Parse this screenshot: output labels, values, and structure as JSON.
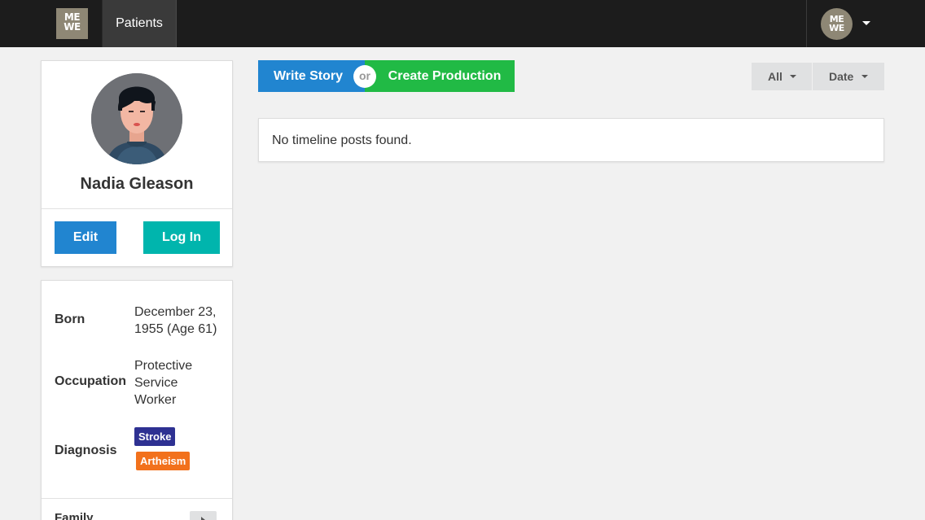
{
  "nav": {
    "logo_line1": "ME",
    "logo_line2": "WE",
    "patients_label": "Patients",
    "avatar_line1": "ME",
    "avatar_line2": "WE"
  },
  "profile": {
    "name": "Nadia Gleason",
    "edit_label": "Edit",
    "login_label": "Log In"
  },
  "info": {
    "born_label": "Born",
    "born_value": "December 23, 1955 (Age 61)",
    "occupation_label": "Occupation",
    "occupation_value": "Protective Service Worker",
    "diagnosis_label": "Diagnosis",
    "diagnoses": [
      "Stroke",
      "Artheism"
    ],
    "family_label": "Family"
  },
  "actions": {
    "write_story": "Write Story",
    "or": "or",
    "create_production": "Create Production"
  },
  "filters": {
    "type_selected": "All",
    "sort_selected": "Date"
  },
  "timeline": {
    "empty_message": "No timeline posts found."
  },
  "colors": {
    "nav_bg": "#1c1c1c",
    "blue": "#2185d0",
    "teal": "#00b5ad",
    "green": "#21ba45",
    "stroke_tag": "#2e3192",
    "artheism_tag": "#f2711c"
  }
}
